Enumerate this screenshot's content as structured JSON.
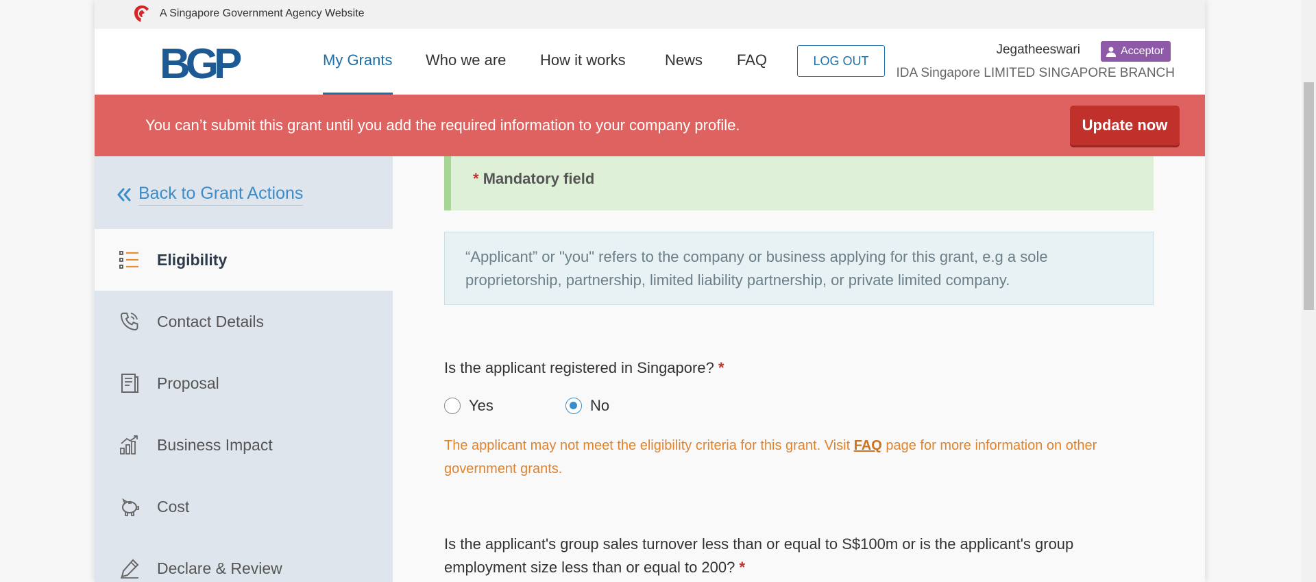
{
  "gov_bar": {
    "text": "A Singapore Government Agency Website"
  },
  "header": {
    "logo": "BGP",
    "nav": [
      "My Grants",
      "Who we are",
      "How it works",
      "News",
      "FAQ"
    ],
    "active_nav": "My Grants",
    "logout_label": "LOG OUT",
    "user_name": "Jegatheeswari",
    "role": "Acceptor",
    "org_name": "IDA Singapore LIMITED SINGAPORE BRANCH"
  },
  "alert": {
    "text": "You can’t submit this grant until you add the required information to your company profile.",
    "button": "Update now"
  },
  "sidebar": {
    "back_label": "Back to Grant Actions",
    "items": [
      {
        "label": "Eligibility",
        "icon": "list-icon",
        "active": true
      },
      {
        "label": "Contact Details",
        "icon": "phone-icon",
        "active": false
      },
      {
        "label": "Proposal",
        "icon": "document-icon",
        "active": false
      },
      {
        "label": "Business Impact",
        "icon": "chart-icon",
        "active": false
      },
      {
        "label": "Cost",
        "icon": "piggy-bank-icon",
        "active": false
      },
      {
        "label": "Declare & Review",
        "icon": "pen-icon",
        "active": false
      }
    ]
  },
  "form": {
    "mandatory_note": "Mandatory field",
    "required_marker": "*",
    "info_text": "“Applicant” or \"you\" refers to the company or business applying for this grant, e.g a sole proprietorship, partnership, limited liability partnership, or private limited company.",
    "q1": {
      "text": "Is the applicant registered in Singapore?",
      "options": [
        "Yes",
        "No"
      ],
      "selected": "No"
    },
    "warning": {
      "before": "The applicant may not meet the eligibility criteria for this grant. Visit ",
      "link": "FAQ",
      "after": " page for more information on other government grants."
    },
    "q2": {
      "text": "Is the applicant's group sales turnover less than or equal to S$100m or is the applicant's group employment size less than or equal to 200?"
    }
  },
  "colors": {
    "primary": "#1d6fa5",
    "alert_bg": "#de6360",
    "update_btn": "#c0312c",
    "role_badge": "#8e5aa7",
    "warning_text": "#e0832b"
  }
}
